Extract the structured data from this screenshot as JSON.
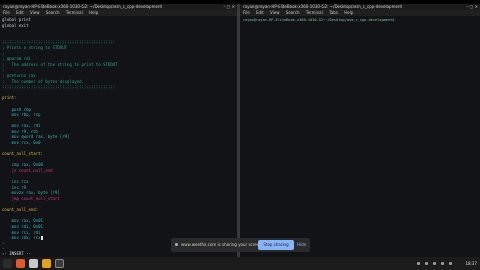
{
  "left_window": {
    "title": "rayan@rayan-HP-EliteBook-x360-1030-G2: ~/Desktop/asm_c_cpp-development",
    "menu": [
      "File",
      "Edit",
      "View",
      "Search",
      "Terminal",
      "Help"
    ],
    "code_lines": [
      {
        "t": "global print",
        "c": "c-plain"
      },
      {
        "t": "global exit",
        "c": "c-plain"
      },
      {
        "t": "",
        "c": "c-plain"
      },
      {
        "t": "",
        "c": "c-plain"
      },
      {
        "t": ";;;;;;;;;;;;;;;;;;;;;;;;;;;;;;;;;;;;;;;;;;;;;;;",
        "c": "c-comment"
      },
      {
        "t": "; Prints a string to STDOUT",
        "c": "c-comment"
      },
      {
        "t": ";",
        "c": "c-comment"
      },
      {
        "t": "; @param rdi",
        "c": "c-comment"
      },
      {
        "t": ";   The address of the string to print to STDOUT",
        "c": "c-comment"
      },
      {
        "t": ";",
        "c": "c-comment"
      },
      {
        "t": "; @returns rax",
        "c": "c-comment"
      },
      {
        "t": ";   The number of bytes displayed.",
        "c": "c-comment"
      },
      {
        "t": ";;;;;;;;;;;;;;;;;;;;;;;;;;;;;;;;;;;;;;;;;;;;;;;",
        "c": "c-comment"
      },
      {
        "t": "",
        "c": "c-plain"
      },
      {
        "t": "print:",
        "c": "c-label"
      },
      {
        "t": "",
        "c": "c-plain"
      },
      {
        "t": "    push rbp",
        "c": "c-instr"
      },
      {
        "t": "    mov rbp, rsp",
        "c": "c-instr"
      },
      {
        "t": "",
        "c": "c-plain"
      },
      {
        "t": "    mov rax, rdi",
        "c": "c-instr"
      },
      {
        "t": "    mov r9, rdi",
        "c": "c-instr"
      },
      {
        "t": "    mov qword rax, byte [r9]",
        "c": "c-instr"
      },
      {
        "t": "    mov rcx, 0x0",
        "c": "c-instr"
      },
      {
        "t": "",
        "c": "c-plain"
      },
      {
        "t": "count_null_start:",
        "c": "c-label"
      },
      {
        "t": "",
        "c": "c-plain"
      },
      {
        "t": "    cmp rax, 0x00",
        "c": "c-instr"
      },
      {
        "t": "    je count_null_end",
        "c": "c-kw"
      },
      {
        "t": "",
        "c": "c-plain"
      },
      {
        "t": "    inc rcx",
        "c": "c-instr"
      },
      {
        "t": "    inc r9",
        "c": "c-instr"
      },
      {
        "t": "    movzx rax, byte [r9]",
        "c": "c-instr"
      },
      {
        "t": "    jmp count_null_start",
        "c": "c-kw"
      },
      {
        "t": "",
        "c": "c-plain"
      },
      {
        "t": "count_null_end:",
        "c": "c-label"
      },
      {
        "t": "",
        "c": "c-plain"
      },
      {
        "t": "    mov rax, 0x01",
        "c": "c-instr"
      },
      {
        "t": "    mov rdi, 0x01",
        "c": "c-instr"
      },
      {
        "t": "    mov rsi, rdi",
        "c": "c-instr"
      },
      {
        "t": "    mov rdx, rcx",
        "c": "c-instr"
      },
      {
        "t": "~",
        "c": "c-tilde"
      },
      {
        "t": "~",
        "c": "c-tilde"
      },
      {
        "t": "~",
        "c": "c-tilde"
      }
    ],
    "mode": "-- INSERT --"
  },
  "right_window": {
    "title": "rayan@rayan-HP-EliteBook-x360-1030-G2: ~/Desktop/asm_c_cpp-development",
    "menu": [
      "File",
      "Edit",
      "View",
      "Search",
      "Terminal",
      "Tabs",
      "Help"
    ],
    "prompt": "rayan@rayan-HP-EliteBook-x360-1030-G2:~/Desktop/asm_c_cpp-development$"
  },
  "share_bar": {
    "message": "www.weetha.com is sharing your screen.",
    "stop_label": "Stop sharing",
    "hide_label": "Hide"
  },
  "taskbar": {
    "clock": "18:37"
  },
  "colors": {
    "accent": "#8ab4f8",
    "comment": "#2aa198",
    "label": "#e7b93b"
  }
}
